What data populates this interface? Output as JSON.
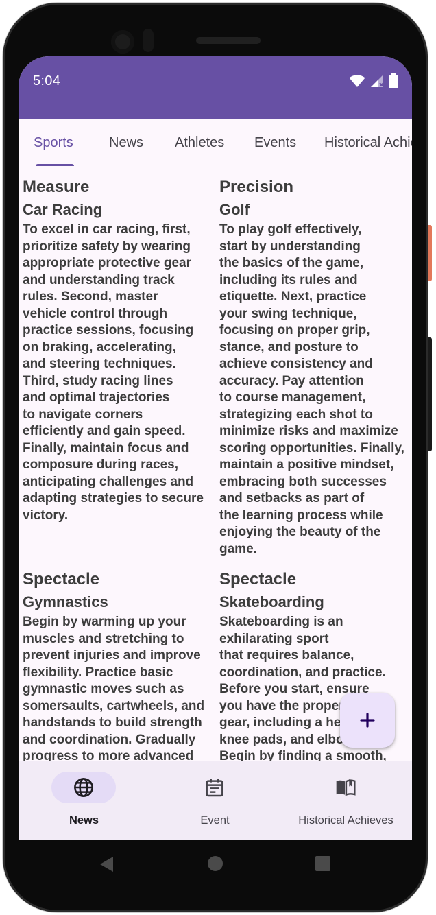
{
  "status_bar": {
    "time": "5:04",
    "background": "#6750a4",
    "icons": [
      "wifi-icon",
      "signal-icon",
      "battery-icon"
    ]
  },
  "tabs": [
    {
      "label": "Sports",
      "active": true
    },
    {
      "label": "News",
      "active": false
    },
    {
      "label": "Athletes",
      "active": false
    },
    {
      "label": "Events",
      "active": false
    },
    {
      "label": "Historical Achieves",
      "active": false
    }
  ],
  "cards": [
    {
      "title": "Measure",
      "subtitle": "Car Racing",
      "body": "To excel in car racing, first,\nprioritize safety by wearing\nappropriate protective gear\nand understanding track\nrules. Second, master\nvehicle control through\npractice sessions, focusing\non braking, accelerating,\nand steering techniques.\nThird, study racing lines\nand optimal trajectories\nto navigate corners\nefficiently and gain speed.\nFinally, maintain focus and\ncomposure during races,\nanticipating challenges and\nadapting strategies to secure\nvictory."
    },
    {
      "title": "Precision",
      "subtitle": "Golf",
      "body": "To play golf effectively,\nstart by understanding\nthe basics of the game,\nincluding its rules and\netiquette. Next, practice\nyour swing technique,\nfocusing on proper grip,\nstance, and posture to\nachieve consistency and\naccuracy. Pay attention\nto course management,\nstrategizing each shot to\nminimize risks and maximize\nscoring opportunities. Finally,\nmaintain a positive mindset,\nembracing both successes\nand setbacks as part of\nthe learning process while\nenjoying the beauty of the\ngame."
    },
    {
      "title": "Spectacle",
      "subtitle": "Gymnastics",
      "body": "Begin by warming up your\nmuscles and stretching to\nprevent injuries and improve\nflexibility. Practice basic\ngymnastic moves such as\nsomersaults, cartwheels, and\nhandstands to build strength\nand coordination. Gradually\nprogress to more advanced"
    },
    {
      "title": "Spectacle",
      "subtitle": "Skateboarding",
      "body": "Skateboarding is an\nexhilarating sport\nthat requires balance,\ncoordination, and practice.\nBefore you start, ensure\nyou have the proper\ngear, including a helmet,\nknee pads, and elbow pads.\nBegin by finding a smooth,"
    }
  ],
  "fab": {
    "icon": "plus-icon"
  },
  "bottom_nav": [
    {
      "label": "News",
      "icon": "globe-icon",
      "active": true
    },
    {
      "label": "Event",
      "icon": "calendar-icon",
      "active": false
    },
    {
      "label": "Historical Achieves",
      "icon": "book-icon",
      "active": false
    }
  ],
  "system_nav": [
    "back-icon",
    "home-icon",
    "recents-icon"
  ],
  "colors": {
    "accent": "#6750a4",
    "surface": "#fdf7fd",
    "nav_surface": "#f2ebf6",
    "active_pill": "#e4dbf6",
    "fab": "#ece2fb",
    "text": "#3d3d3d"
  }
}
